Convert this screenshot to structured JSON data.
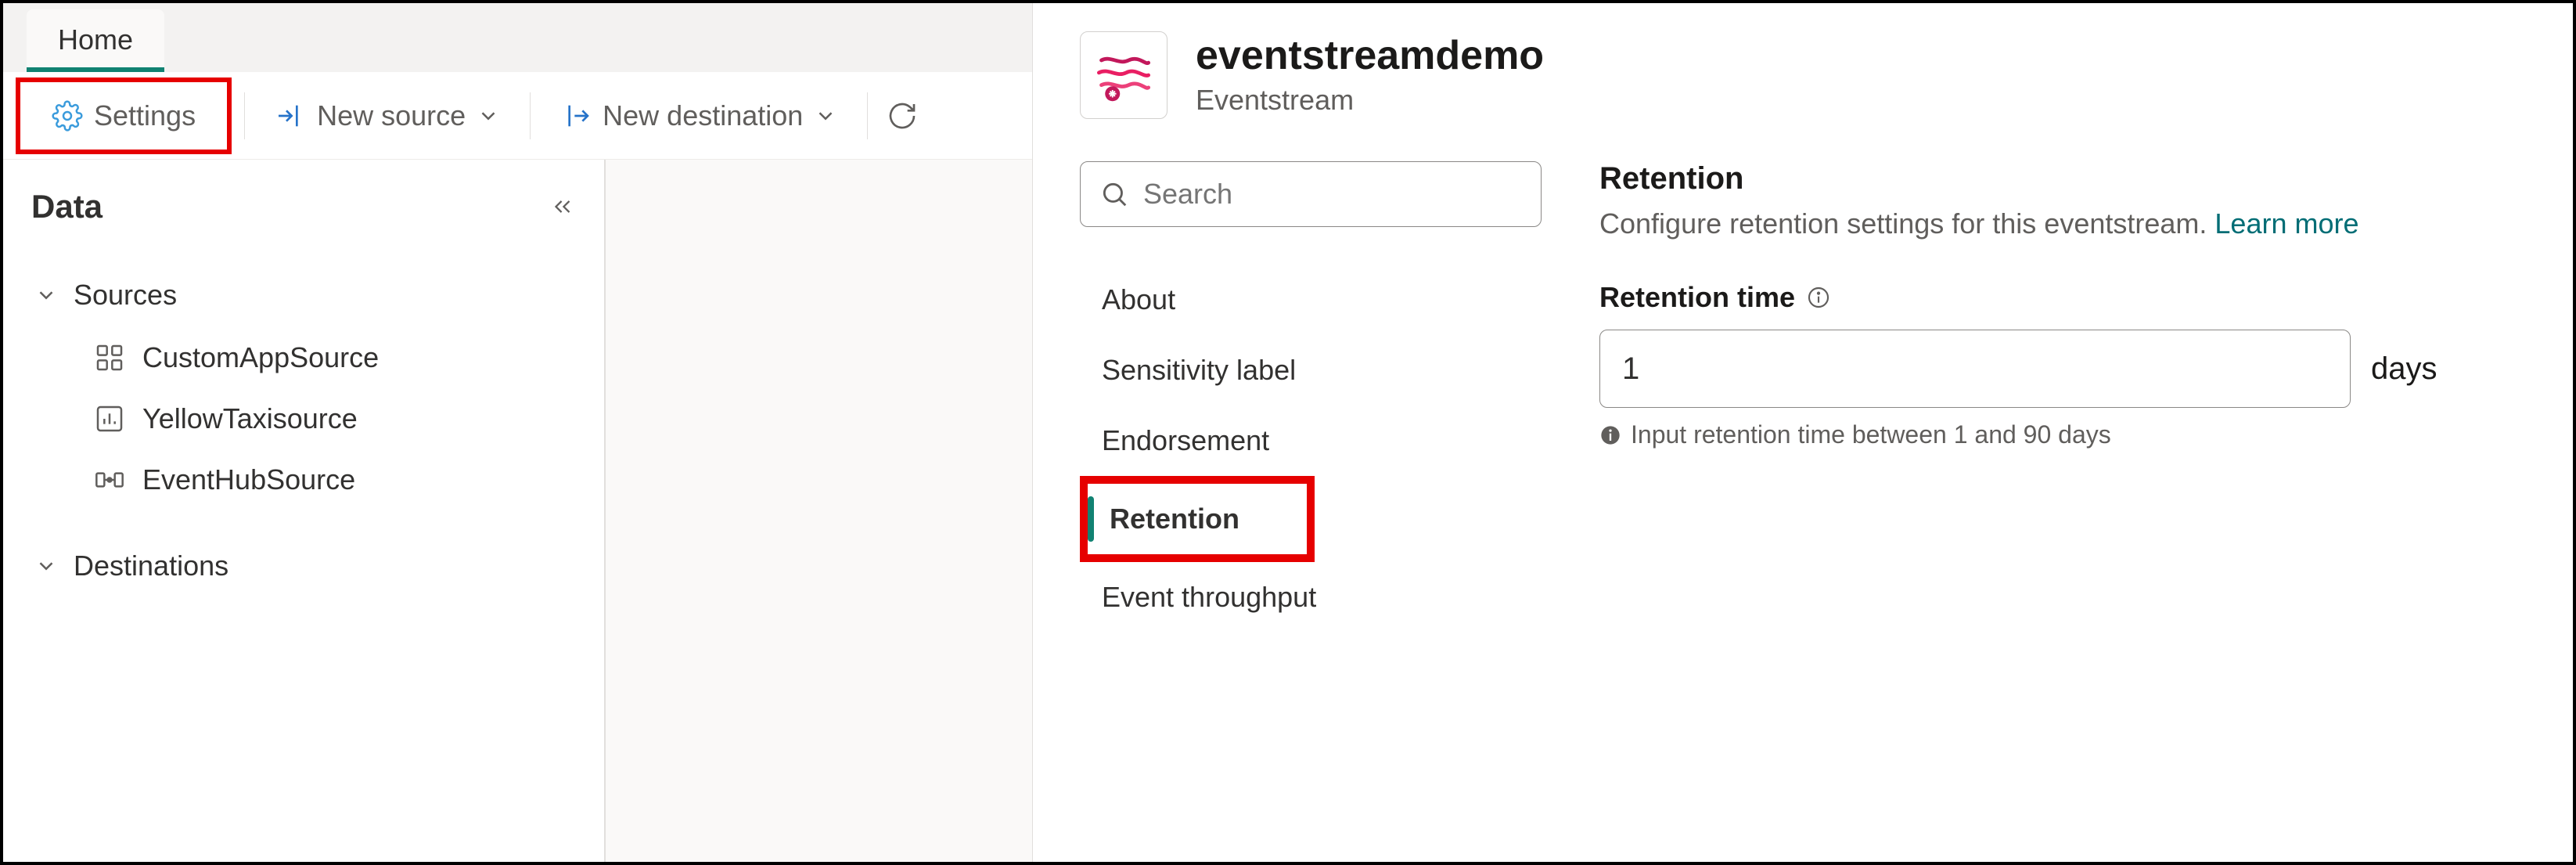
{
  "tabs": {
    "home": "Home"
  },
  "toolbar": {
    "settings": "Settings",
    "new_source": "New source",
    "new_destination": "New destination"
  },
  "data_panel": {
    "title": "Data",
    "sections": {
      "sources": {
        "label": "Sources",
        "items": [
          {
            "label": "CustomAppSource"
          },
          {
            "label": "YellowTaxisource"
          },
          {
            "label": "EventHubSource"
          }
        ]
      },
      "destinations": {
        "label": "Destinations"
      }
    }
  },
  "settings_panel": {
    "title": "eventstreamdemo",
    "subtitle": "Eventstream",
    "search_placeholder": "Search",
    "nav": {
      "about": "About",
      "sensitivity": "Sensitivity label",
      "endorsement": "Endorsement",
      "retention": "Retention",
      "event_throughput": "Event throughput"
    },
    "retention": {
      "heading": "Retention",
      "description": "Configure retention settings for this eventstream.",
      "learn_more": "Learn more",
      "field_label": "Retention time",
      "value": "1",
      "unit": "days",
      "hint": "Input retention time between 1 and 90 days"
    }
  }
}
